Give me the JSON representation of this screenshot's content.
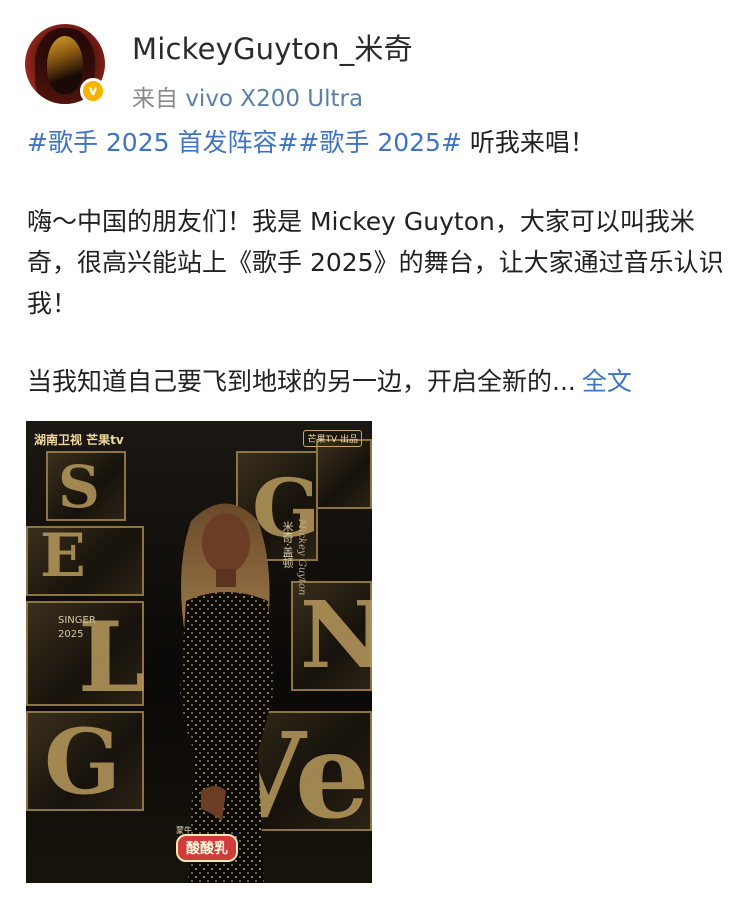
{
  "header": {
    "username": "MickeyGuyton_米奇",
    "source_prefix": "来自",
    "source_device": "vivo X200 Ultra",
    "verified_mark": "v"
  },
  "post": {
    "hashtag_1": "#歌手 2025 首发阵容#",
    "hashtag_2": "#歌手 2025#",
    "hashtag_tail": " 听我来唱！",
    "paragraph_1": "嗨～中国的朋友们！我是 Mickey Guyton，大家可以叫我米奇，很高兴能站上《歌手 2025》的舞台，让大家通过音乐认识我！",
    "paragraph_2": "当我知道自己要飞到地球的另一边，开启全新的...",
    "more_link": "全文"
  },
  "poster": {
    "logo_left": "湖南卫视 芒果tv",
    "logo_right": "芒果TV 出品",
    "singer_label_1": "SINGER",
    "singer_label_2": "2025",
    "name_cn": "米奇·盖顿",
    "name_en": "Mickey Guyton",
    "sponsor_small": "蒙牛",
    "sponsor": "酸酸乳"
  },
  "colors": {
    "link": "#3f74c4",
    "badge": "#f6b400",
    "meta_text": "#8a8a8a"
  },
  "icons": {
    "verified": "verified-badge-icon"
  }
}
